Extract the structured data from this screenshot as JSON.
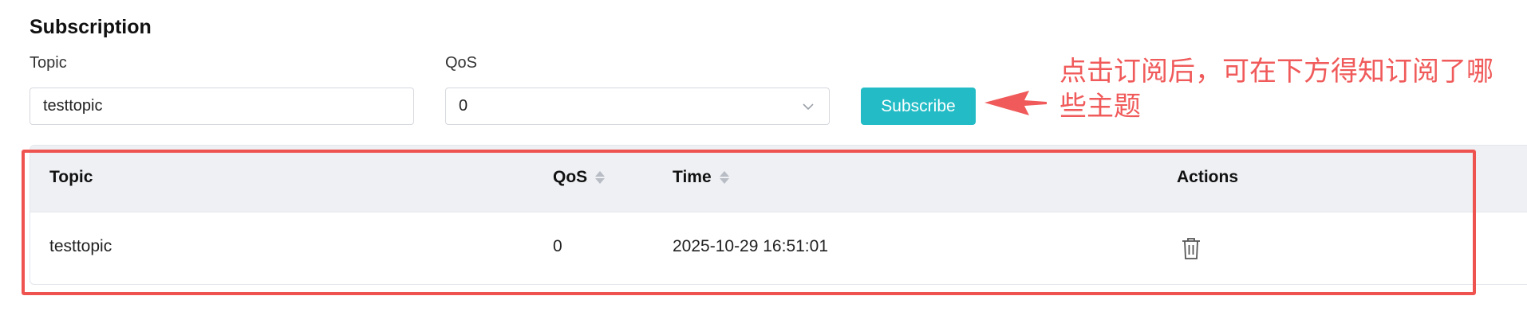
{
  "section": {
    "title": "Subscription"
  },
  "form": {
    "topic_label": "Topic",
    "topic_value": "testtopic",
    "qos_label": "QoS",
    "qos_value": "0",
    "subscribe_label": "Subscribe"
  },
  "annotation": {
    "text": "点击订阅后，可在下方得知订阅了哪些主题",
    "color": "#f05a5a"
  },
  "table": {
    "columns": [
      "Topic",
      "QoS",
      "Time",
      "Actions"
    ],
    "rows": [
      {
        "topic": "testtopic",
        "qos": "0",
        "time": "2025-10-29 16:51:01",
        "action_icon": "trash-icon"
      }
    ]
  },
  "colors": {
    "accent": "#23bcc6",
    "highlight": "#ef5350",
    "header_bg": "#eef0f4"
  }
}
